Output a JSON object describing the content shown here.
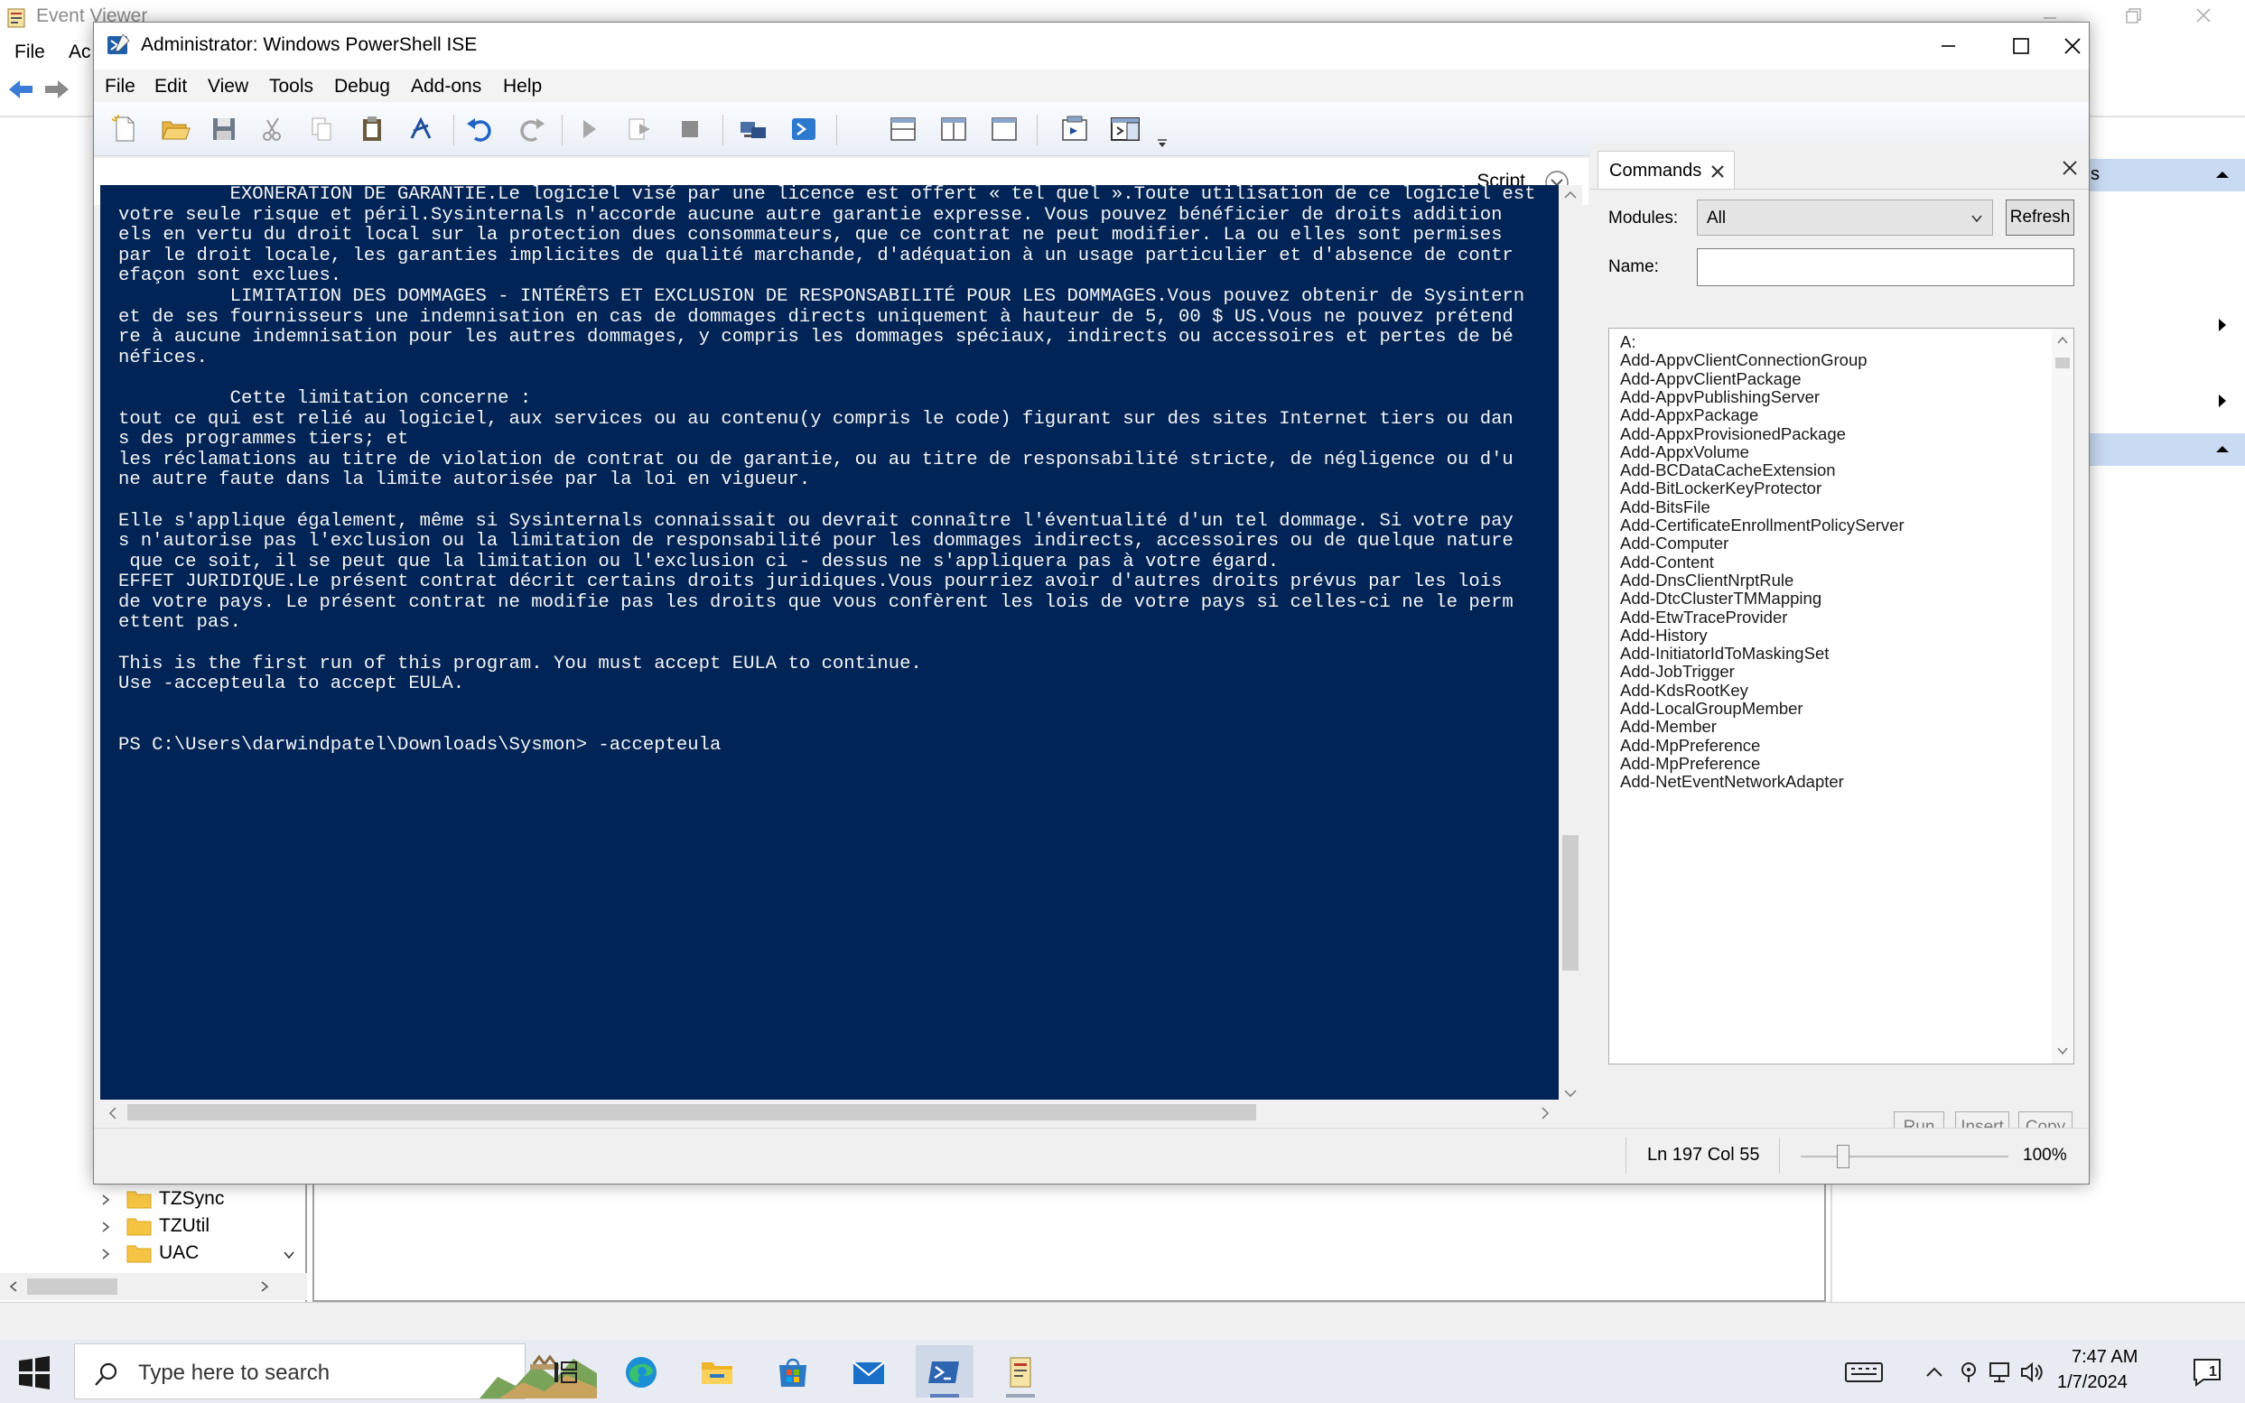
{
  "event_viewer": {
    "title": "Event Viewer",
    "menu": [
      "File",
      "Ac"
    ],
    "tree_items": [
      "TZSync",
      "TZUtil",
      "UAC"
    ],
    "actions_header_suffix": "s"
  },
  "ise": {
    "title": "Administrator: Windows PowerShell ISE",
    "menu": [
      "File",
      "Edit",
      "View",
      "Tools",
      "Debug",
      "Add-ons",
      "Help"
    ],
    "script_label": "Script",
    "console_lines": [
      "          EXONERATION DE GARANTIE.Le logiciel visé par une licence est offert « tel quel ».Toute utilisation de ce logiciel est",
      "votre seule risque et péril.Sysinternals n'accorde aucune autre garantie expresse. Vous pouvez bénéficier de droits addition",
      "els en vertu du droit local sur la protection dues consommateurs, que ce contrat ne peut modifier. La ou elles sont permises",
      "par le droit locale, les garanties implicites de qualité marchande, d'adéquation à un usage particulier et d'absence de contr",
      "efaçon sont exclues.",
      "          LIMITATION DES DOMMAGES - INTÉRÊTS ET EXCLUSION DE RESPONSABILITÉ POUR LES DOMMAGES.Vous pouvez obtenir de Sysintern",
      "et de ses fournisseurs une indemnisation en cas de dommages directs uniquement à hauteur de 5, 00 $ US.Vous ne pouvez prétend",
      "re à aucune indemnisation pour les autres dommages, y compris les dommages spéciaux, indirects ou accessoires et pertes de bé",
      "néfices.",
      "",
      "          Cette limitation concerne :",
      "tout ce qui est relié au logiciel, aux services ou au contenu(y compris le code) figurant sur des sites Internet tiers ou dan",
      "s des programmes tiers; et",
      "les réclamations au titre de violation de contrat ou de garantie, ou au titre de responsabilité stricte, de négligence ou d'u",
      "ne autre faute dans la limite autorisée par la loi en vigueur.",
      "",
      "Elle s'applique également, même si Sysinternals connaissait ou devrait connaître l'éventualité d'un tel dommage. Si votre pay",
      "s n'autorise pas l'exclusion ou la limitation de responsabilité pour les dommages indirects, accessoires ou de quelque nature",
      " que ce soit, il se peut que la limitation ou l'exclusion ci - dessus ne s'appliquera pas à votre égard.",
      "EFFET JURIDIQUE.Le présent contrat décrit certains droits juridiques.Vous pourriez avoir d'autres droits prévus par les lois",
      "de votre pays. Le présent contrat ne modifie pas les droits que vous confèrent les lois de votre pays si celles-ci ne le perm",
      "ettent pas.",
      "",
      "This is the first run of this program. You must accept EULA to continue.",
      "Use -accepteula to accept EULA.",
      "",
      "",
      "PS C:\\Users\\darwindpatel\\Downloads\\Sysmon> -accepteula"
    ],
    "commands": {
      "tab_label": "Commands",
      "modules_label": "Modules:",
      "modules_value": "All",
      "refresh_label": "Refresh",
      "name_label": "Name:",
      "name_value": "",
      "items": [
        "A:",
        "Add-AppvClientConnectionGroup",
        "Add-AppvClientPackage",
        "Add-AppvPublishingServer",
        "Add-AppxPackage",
        "Add-AppxProvisionedPackage",
        "Add-AppxVolume",
        "Add-BCDataCacheExtension",
        "Add-BitLockerKeyProtector",
        "Add-BitsFile",
        "Add-CertificateEnrollmentPolicyServer",
        "Add-Computer",
        "Add-Content",
        "Add-DnsClientNrptRule",
        "Add-DtcClusterTMMapping",
        "Add-EtwTraceProvider",
        "Add-History",
        "Add-InitiatorIdToMaskingSet",
        "Add-JobTrigger",
        "Add-KdsRootKey",
        "Add-LocalGroupMember",
        "Add-Member",
        "Add-MpPreference",
        "Add-MpPreference",
        "Add-NetEventNetworkAdapter"
      ],
      "buttons": {
        "run": "Run",
        "insert": "Insert",
        "copy": "Copy"
      }
    },
    "status": {
      "ln_col": "Ln 197  Col 55",
      "zoom": "100%"
    }
  },
  "taskbar": {
    "search_placeholder": "Type here to search",
    "time": "7:47 AM",
    "date": "1/7/2024",
    "apps": [
      "task-view",
      "edge",
      "file-explorer",
      "store",
      "mail",
      "powershell-ise",
      "event-viewer"
    ],
    "active_app": "powershell-ise"
  },
  "colors": {
    "console_bg": "#012456",
    "console_fg": "#F5F5F5",
    "taskbar_bg": "#E8ECF2",
    "actions_header": "#C9DBF3"
  }
}
